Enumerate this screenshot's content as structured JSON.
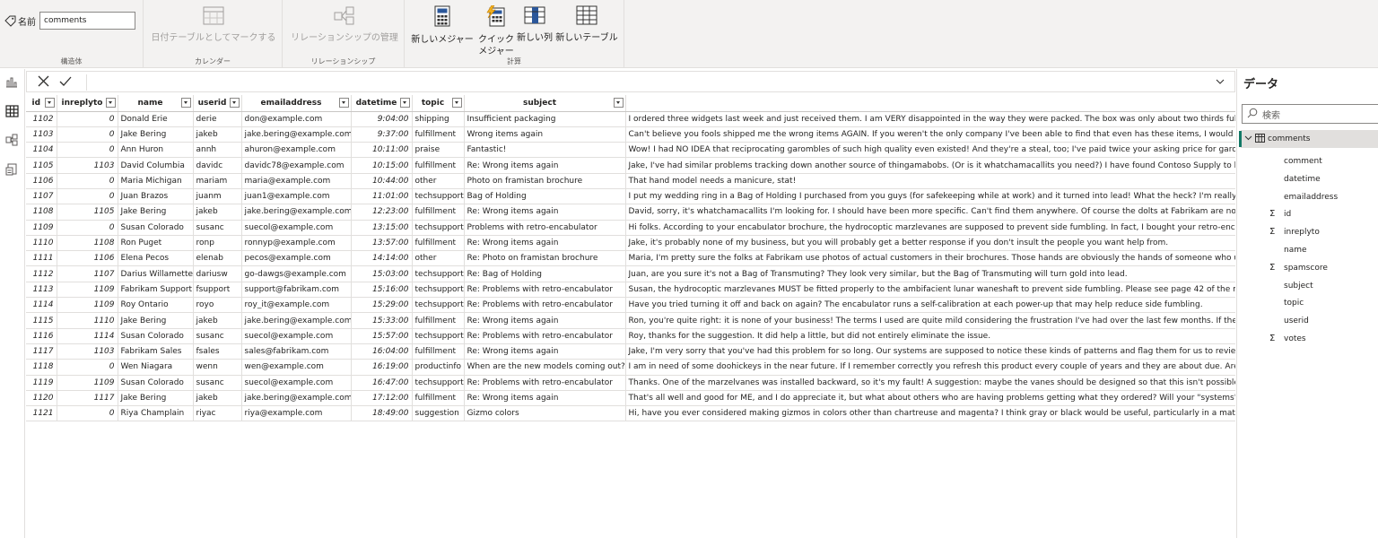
{
  "ribbon": {
    "name_label": "名前",
    "name_value": "comments",
    "groups": {
      "structure": "構造体",
      "calendar": "カレンダー",
      "relationships": "リレーションシップ",
      "calculations": "計算"
    },
    "buttons": {
      "mark_date_table": "日付テーブルとしてマークする",
      "manage_relationships": "リレーションシップの管理",
      "new_measure": "新しいメジャー",
      "quick_measure_line1": "クイック",
      "quick_measure_line2": "メジャー",
      "new_column": "新しい列",
      "new_table": "新しいテーブル"
    }
  },
  "columns": [
    "id",
    "inreplyto",
    "name",
    "userid",
    "emailaddress",
    "datetime",
    "topic",
    "subject",
    ""
  ],
  "rows": [
    [
      "1102",
      "0",
      "Donald Erie",
      "derie",
      "don@example.com",
      "9:04:00",
      "shipping",
      "Insufficient packaging",
      "I ordered three widgets last week and just received them. I am VERY disappointed in the way they were packed. The box was only about two thirds full of packing"
    ],
    [
      "1103",
      "0",
      "Jake Bering",
      "jakeb",
      "jake.bering@example.com",
      "9:37:00",
      "fulfillment",
      "Wrong items again",
      "Can't believe you fools shipped me the wrong items AGAIN. If you weren't the only company I've been able to find that even has these items, I would have sto"
    ],
    [
      "1104",
      "0",
      "Ann Huron",
      "annh",
      "ahuron@example.com",
      "10:11:00",
      "praise",
      "Fantastic!",
      "Wow! I had NO IDEA that reciprocating garombles of such high quality even existed! And they're a steal, too; I've paid twice your asking price for garombles of"
    ],
    [
      "1105",
      "1103",
      "David Columbia",
      "davidc",
      "davidc78@example.com",
      "10:15:00",
      "fulfillment",
      "Re: Wrong items again",
      "Jake, I've had similar problems tracking down another source of thingamabobs. (Or is it whatchamacallits you need?) I have found Contoso Supply to have th"
    ],
    [
      "1106",
      "0",
      "Maria Michigan",
      "mariam",
      "maria@example.com",
      "10:44:00",
      "other",
      "Photo on framistan brochure",
      "That hand model needs a manicure, stat!"
    ],
    [
      "1107",
      "0",
      "Juan Brazos",
      "juanm",
      "juan1@example.com",
      "11:01:00",
      "techsupport",
      "Bag of Holding",
      "I put my wedding ring in a Bag of Holding I purchased from you guys (for safekeeping while at work) and it turned into lead! What the heck? I'm really going t"
    ],
    [
      "1108",
      "1105",
      "Jake Bering",
      "jakeb",
      "jake.bering@example.com",
      "12:23:00",
      "fulfillment",
      "Re: Wrong items again",
      "David, sorry, it's whatchamacallits I'm looking for. I should have been more specific. Can't find them anywhere. Of course the dolts at Fabrikam are no help."
    ],
    [
      "1109",
      "0",
      "Susan Colorado",
      "susanc",
      "suecol@example.com",
      "13:15:00",
      "techsupport",
      "Problems with retro-encabulator",
      "Hi folks. According to your encabulator brochure, the hydrocoptic marzlevanes are supposed to prevent side fumbling. In fact, I bought your retro-encabulator"
    ],
    [
      "1110",
      "1108",
      "Ron Puget",
      "ronp",
      "ronnyp@example.com",
      "13:57:00",
      "fulfillment",
      "Re: Wrong items again",
      "Jake, it's probably none of my business, but you will probably get a better response if you don't insult the people you want help from."
    ],
    [
      "1111",
      "1106",
      "Elena Pecos",
      "elenab",
      "pecos@example.com",
      "14:14:00",
      "other",
      "Re: Photo on framistan brochure",
      "Maria, I'm pretty sure the folks at Fabrikam use photos of actual customers in their brochures. Those hands are obviously the hands of someone who uses the"
    ],
    [
      "1112",
      "1107",
      "Darius Willamette",
      "dariusw",
      "go-dawgs@example.com",
      "15:03:00",
      "techsupport",
      "Re: Bag of Holding",
      "Juan, are you sure it's not a Bag of Transmuting? They look very similar, but the Bag of Transmuting will turn gold into lead."
    ],
    [
      "1113",
      "1109",
      "Fabrikam Support",
      "fsupport",
      "support@fabrikam.com",
      "15:16:00",
      "techsupport",
      "Re: Problems with retro-encabulator",
      "Susan, the hydrocoptic marzlevanes MUST be fitted properly to the ambifacient lunar waneshaft to prevent side fumbling. Please see page 42 of the manual."
    ],
    [
      "1114",
      "1109",
      "Roy Ontario",
      "royo",
      "roy_it@example.com",
      "15:29:00",
      "techsupport",
      "Re: Problems with retro-encabulator",
      "Have you tried turning it off and back on again? The encabulator runs a self-calibration at each power-up that may help reduce side fumbling."
    ],
    [
      "1115",
      "1110",
      "Jake Bering",
      "jakeb",
      "jake.bering@example.com",
      "15:33:00",
      "fulfillment",
      "Re: Wrong items again",
      "Ron, you're quite right: it is none of your business! The terms I used are quite mild considering the frustration I've had over the last few months. If they don't"
    ],
    [
      "1116",
      "1114",
      "Susan Colorado",
      "susanc",
      "suecol@example.com",
      "15:57:00",
      "techsupport",
      "Re: Problems with retro-encabulator",
      "Roy, thanks for the suggestion. It did help a little, but did not entirely eliminate the issue."
    ],
    [
      "1117",
      "1103",
      "Fabrikam Sales",
      "fsales",
      "sales@fabrikam.com",
      "16:04:00",
      "fulfillment",
      "Re: Wrong items again",
      "Jake, I'm very sorry that you've had this problem for so long. Our systems are supposed to notice these kinds of patterns and flag them for us to review. Obv"
    ],
    [
      "1118",
      "0",
      "Wen Niagara",
      "wenn",
      "wen@example.com",
      "16:19:00",
      "productinfo",
      "When are the new models coming out?",
      "I am in need of some doohickeys in the near future. If I remember correctly you refresh this product every couple of years and they are about due. Are you pl"
    ],
    [
      "1119",
      "1109",
      "Susan Colorado",
      "susanc",
      "suecol@example.com",
      "16:47:00",
      "techsupport",
      "Re: Problems with retro-encabulator",
      "Thanks. One of the marzelvanes was installed backward, so it's my fault! A suggestion: maybe the vanes should be designed so that this isn't possible."
    ],
    [
      "1120",
      "1117",
      "Jake Bering",
      "jakeb",
      "jake.bering@example.com",
      "17:12:00",
      "fulfillment",
      "Re: Wrong items again",
      "That's all well and good for ME, and I do appreciate it, but what about others who are having problems getting what they ordered? Will your \"systems\" be fix"
    ],
    [
      "1121",
      "0",
      "Riya Champlain",
      "riyac",
      "riya@example.com",
      "18:49:00",
      "suggestion",
      "Gizmo colors",
      "Hi, have you ever considered making gizmos in colors other than chartreuse and magenta? I think gray or black would be useful, particularly in a matte finish."
    ]
  ],
  "pane": {
    "title": "データ",
    "search_placeholder": "検索",
    "table_name": "comments",
    "fields": [
      {
        "name": "comment",
        "sigma": false
      },
      {
        "name": "datetime",
        "sigma": false
      },
      {
        "name": "emailaddress",
        "sigma": false
      },
      {
        "name": "id",
        "sigma": true
      },
      {
        "name": "inreplyto",
        "sigma": true
      },
      {
        "name": "name",
        "sigma": false
      },
      {
        "name": "spamscore",
        "sigma": true
      },
      {
        "name": "subject",
        "sigma": false
      },
      {
        "name": "topic",
        "sigma": false
      },
      {
        "name": "userid",
        "sigma": false
      },
      {
        "name": "votes",
        "sigma": true
      }
    ]
  },
  "icons": {
    "rail": [
      "report-view-icon",
      "table-view-icon",
      "model-view-icon",
      "dax-query-view-icon"
    ]
  },
  "colors": {
    "accent": "#117865",
    "grid_border": "#e1dfdd",
    "ribbon_bg": "#f3f2f1"
  }
}
